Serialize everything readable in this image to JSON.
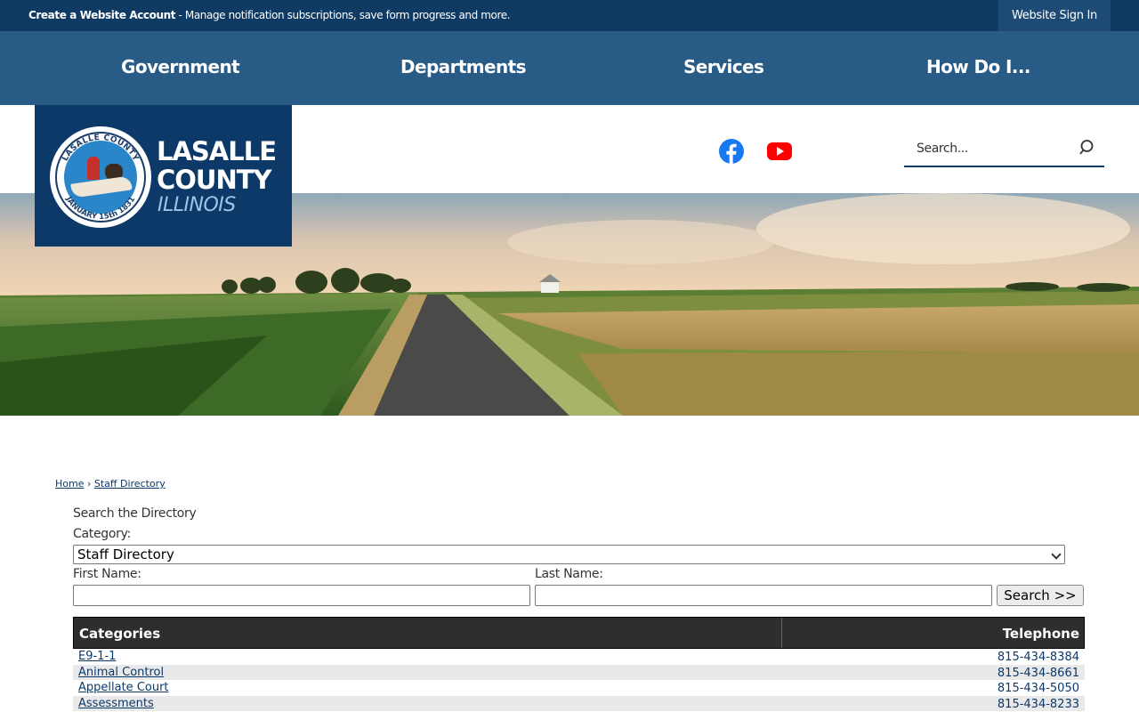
{
  "topbar": {
    "create_account_link": "Create a Website Account",
    "create_account_desc": " - Manage notification subscriptions, save form progress and more.",
    "sign_in": "Website Sign In"
  },
  "nav": {
    "items": [
      {
        "label": "Government"
      },
      {
        "label": "Departments"
      },
      {
        "label": "Services"
      },
      {
        "label": "How Do I..."
      }
    ]
  },
  "logo": {
    "line1": "LASALLE",
    "line2": "COUNTY",
    "line3": "ILLINOIS",
    "seal_top": "LASALLE COUNTY",
    "seal_bottom": "JANUARY 15th 1831"
  },
  "social": [
    {
      "icon": "facebook-icon",
      "color": "#1877f2"
    },
    {
      "icon": "youtube-icon",
      "color": "#ff0000"
    }
  ],
  "search": {
    "placeholder": "Search..."
  },
  "breadcrumb": {
    "home": "Home",
    "separator": "›",
    "current": "Staff Directory"
  },
  "form": {
    "heading": "Search the Directory",
    "category_label": "Category:",
    "category_value": "Staff Directory",
    "first_name_label": "First Name:",
    "last_name_label": "Last Name:",
    "first_name_value": "",
    "last_name_value": "",
    "search_button": "Search >>"
  },
  "table": {
    "headers": {
      "categories": "Categories",
      "telephone": "Telephone"
    },
    "rows": [
      {
        "name": "E9-1-1",
        "phone": "815-434-8384"
      },
      {
        "name": "Animal Control",
        "phone": "815-434-8661"
      },
      {
        "name": "Appellate Court",
        "phone": "815-434-5050"
      },
      {
        "name": "Assessments",
        "phone": "815-434-8233"
      }
    ]
  },
  "colors": {
    "topbar": "#0f3a63",
    "navbar": "#285b85",
    "logo_bg": "#0d3968",
    "link": "#0d3968",
    "table_header": "#2e2e2e"
  }
}
